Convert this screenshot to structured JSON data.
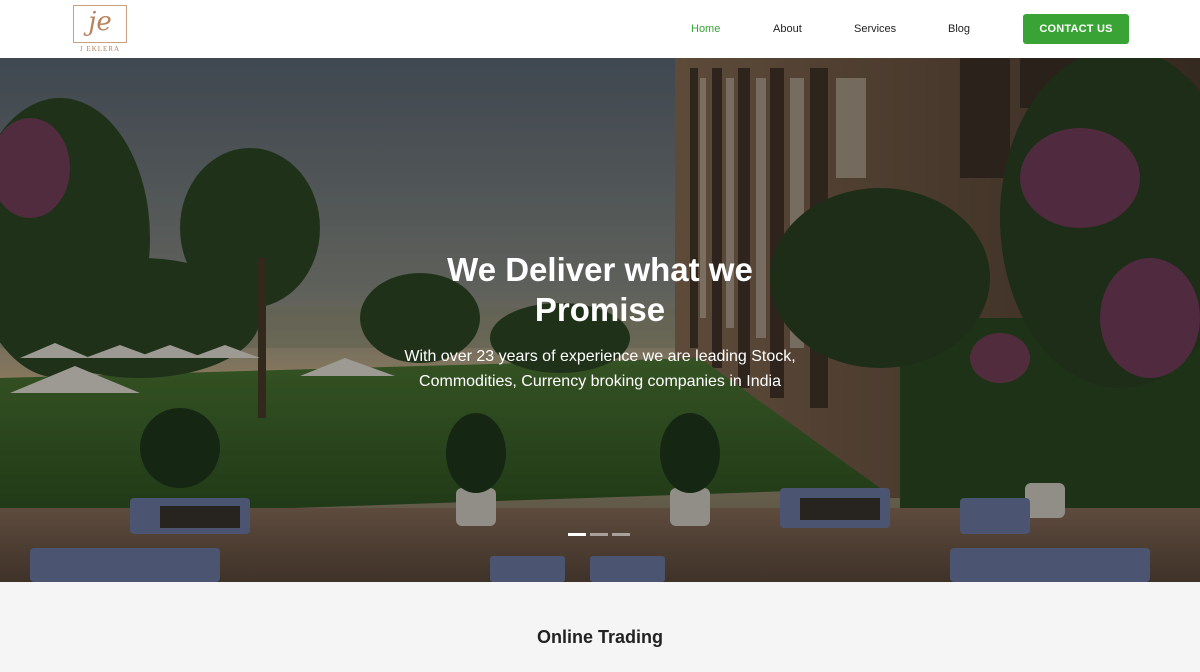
{
  "logo": {
    "glyph": "je",
    "text": "J EKLERA"
  },
  "nav": {
    "items": [
      {
        "label": "Home",
        "active": true
      },
      {
        "label": "About",
        "active": false
      },
      {
        "label": "Services",
        "active": false
      },
      {
        "label": "Blog",
        "active": false
      }
    ],
    "cta_label": "CONTACT US"
  },
  "hero": {
    "title": "We Deliver what we Promise",
    "subtitle": "With over 23 years of experience we are leading Stock, Commodities, Currency broking companies in India",
    "slides": 3,
    "active_slide": 1
  },
  "section": {
    "title": "Online Trading"
  },
  "colors": {
    "accent": "#3aa335",
    "logo": "#b8835d"
  }
}
